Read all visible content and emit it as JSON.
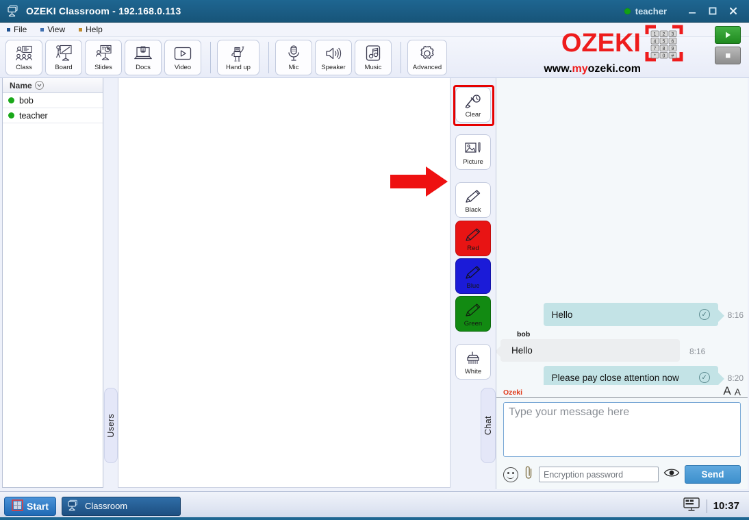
{
  "window": {
    "title": "OZEKI Classroom  -  192.168.0.113",
    "icon": "classroom-icon",
    "user": "teacher",
    "minimize_label": "minimize-icon",
    "maximize_label": "maximize-icon",
    "close_label": "close-icon"
  },
  "menu": {
    "items": [
      {
        "label": "File"
      },
      {
        "label": "View"
      },
      {
        "label": "Help"
      }
    ]
  },
  "toolbar": {
    "groups": [
      {
        "buttons": [
          {
            "label": "Class",
            "icon": "class-icon"
          },
          {
            "label": "Board",
            "icon": "board-icon"
          },
          {
            "label": "Slides",
            "icon": "slides-icon"
          },
          {
            "label": "Docs",
            "icon": "docs-icon"
          },
          {
            "label": "Video",
            "icon": "video-icon"
          }
        ]
      },
      {
        "buttons": [
          {
            "label": "Hand up",
            "icon": "hand-up-icon"
          }
        ]
      },
      {
        "buttons": [
          {
            "label": "Mic",
            "icon": "mic-icon"
          },
          {
            "label": "Speaker",
            "icon": "speaker-icon"
          },
          {
            "label": "Music",
            "icon": "music-icon"
          }
        ]
      },
      {
        "buttons": [
          {
            "label": "Advanced",
            "icon": "gear-icon"
          }
        ]
      }
    ]
  },
  "logo": {
    "brand": "OZEKI",
    "url_prefix": "www.",
    "url_accent": "my",
    "url_suffix": "ozeki.com",
    "keypad_icon": "keypad-icon",
    "keys": [
      "1",
      "2",
      "3",
      "4",
      "5",
      "6",
      "7",
      "8",
      "9",
      "*",
      "0",
      "#"
    ],
    "brand_color": "#ee1c1c",
    "play_button": "play-icon",
    "stop_button": "stop-icon"
  },
  "users_panel": {
    "header": "Name",
    "sort_icon": "chevron-down-icon",
    "users": [
      {
        "name": "bob",
        "status": "online"
      },
      {
        "name": "teacher",
        "status": "online"
      }
    ],
    "tab_label": "Users"
  },
  "tools": {
    "items": [
      {
        "label": "Clear",
        "icon": "clear-icon",
        "color": "#ffffff",
        "highlighted": true
      },
      {
        "label": "Picture",
        "icon": "picture-icon",
        "color": "#ffffff",
        "highlighted": false
      },
      {
        "label": "Black",
        "icon": "pencil-icon",
        "color": "#ffffff",
        "highlighted": false
      },
      {
        "label": "Red",
        "icon": "pencil-icon",
        "color": "#e81414",
        "highlighted": false
      },
      {
        "label": "Blue",
        "icon": "pencil-icon",
        "color": "#1b1bd8",
        "highlighted": false
      },
      {
        "label": "Green",
        "icon": "pencil-icon",
        "color": "#128a12",
        "highlighted": false
      },
      {
        "label": "White",
        "icon": "brush-icon",
        "color": "#ffffff",
        "highlighted": false
      }
    ],
    "annotation_arrow": "red-arrow-pointer"
  },
  "chat": {
    "tab_label": "Chat",
    "messages": [
      {
        "direction": "out",
        "text": "Hello",
        "time": "8:16",
        "status": "delivered",
        "sender": ""
      },
      {
        "direction": "in",
        "text": "Hello",
        "time": "8:16",
        "status": "",
        "sender": "bob"
      },
      {
        "direction": "out",
        "text": "Please pay close attention now",
        "time": "8:20",
        "status": "delivered",
        "sender": ""
      }
    ],
    "provider_tag": "Ozeki",
    "font_large": "A",
    "font_small": "A",
    "compose_placeholder": "Type your message here",
    "compose_value": "",
    "emoji_icon": "emoji-icon",
    "attach_icon": "paperclip-icon",
    "encryption_placeholder": "Encryption password",
    "encryption_value": "",
    "reveal_icon": "eye-icon",
    "send_label": "Send",
    "accent_color": "#3d8fcc"
  },
  "taskbar": {
    "start_label": "Start",
    "start_icon": "windows-icon",
    "items": [
      {
        "label": "Classroom",
        "icon": "classroom-icon"
      }
    ],
    "tray_icon": "monitor-icon",
    "clock": "10:37"
  }
}
